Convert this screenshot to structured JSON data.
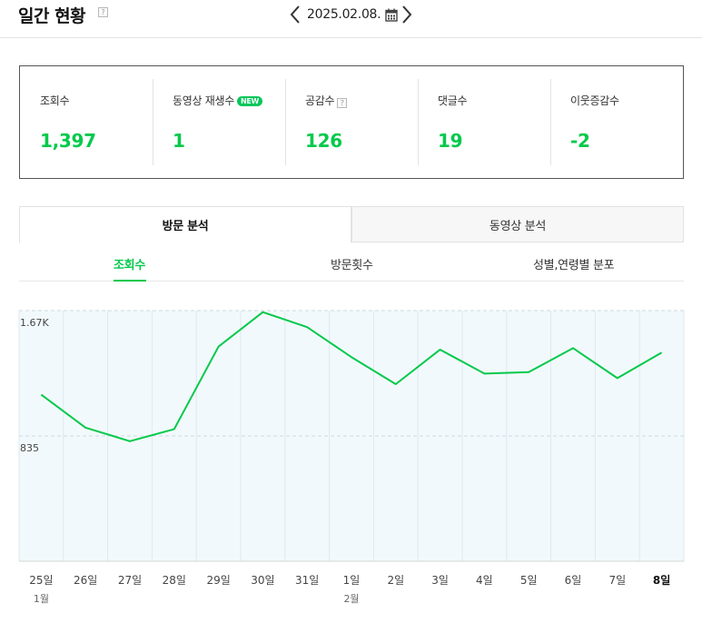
{
  "header": {
    "title": "일간 현황",
    "help": "?",
    "date": "2025.02.08."
  },
  "stats": [
    {
      "label": "조회수",
      "value": "1,397"
    },
    {
      "label": "동영상 재생수",
      "badge": "NEW",
      "value": "1"
    },
    {
      "label": "공감수",
      "help": "?",
      "value": "126"
    },
    {
      "label": "댓글수",
      "value": "19"
    },
    {
      "label": "이웃증감수",
      "value": "-2"
    }
  ],
  "main_tabs": [
    {
      "label": "방문 분석",
      "active": true
    },
    {
      "label": "동영상 분석",
      "active": false
    }
  ],
  "sub_tabs": [
    {
      "label": "조회수",
      "active": true
    },
    {
      "label": "방문횟수",
      "active": false
    },
    {
      "label": "성별,연령별 분포",
      "active": false
    }
  ],
  "colors": {
    "accent": "#03c94b",
    "chart_bg": "#f2f9fc",
    "grid": "#dde9ee"
  },
  "chart_data": {
    "type": "line",
    "series": [
      {
        "values": [
          1110,
          890,
          800,
          880,
          1430,
          1660,
          1560,
          1360,
          1180,
          1410,
          1250,
          1260,
          1420,
          1220,
          1390
        ]
      }
    ],
    "x": [
      "25일",
      "26일",
      "27일",
      "28일",
      "29일",
      "30일",
      "31일",
      "1일",
      "2일",
      "3일",
      "4일",
      "5일",
      "6일",
      "7일",
      "8일"
    ],
    "x_months": [
      "1월",
      "",
      "",
      "",
      "",
      "",
      "",
      "2월",
      "",
      "",
      "",
      "",
      "",
      "",
      ""
    ],
    "y_ticks": [
      835,
      1670
    ],
    "y_tick_labels": [
      "835",
      "1.67K"
    ],
    "ylim": [
      0,
      1670
    ],
    "grid": true
  }
}
